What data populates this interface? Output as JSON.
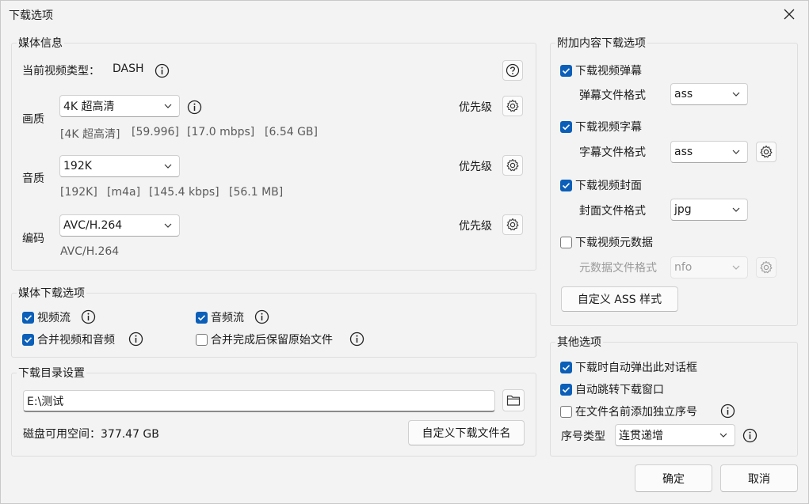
{
  "window": {
    "title": "下载选项"
  },
  "media_info": {
    "group_title": "媒体信息",
    "type_label": "当前视频类型：",
    "type_value": "DASH",
    "quality_label": "画质",
    "quality_value": "4K 超高清",
    "quality_detail": [
      "[4K 超高清]",
      "[59.996]",
      "[17.0 mbps]",
      "[6.54 GB]"
    ],
    "audio_label": "音质",
    "audio_value": "192K",
    "audio_detail": [
      "[192K]",
      "[m4a]",
      "[145.4 kbps]",
      "[56.1 MB]"
    ],
    "codec_label": "编码",
    "codec_value": "AVC/H.264",
    "codec_detail": "AVC/H.264",
    "priority_label": "优先级"
  },
  "media_download": {
    "group_title": "媒体下载选项",
    "video_stream": {
      "label": "视频流",
      "checked": true
    },
    "audio_stream": {
      "label": "音频流",
      "checked": true
    },
    "merge": {
      "label": "合并视频和音频",
      "checked": true
    },
    "keep_original": {
      "label": "合并完成后保留原始文件",
      "checked": false
    }
  },
  "directory": {
    "group_title": "下载目录设置",
    "path": "E:\\测试",
    "disk_label": "磁盘可用空间：377.47 GB",
    "custom_name_button": "自定义下载文件名"
  },
  "extra": {
    "group_title": "附加内容下载选项",
    "danmaku": {
      "label": "下载视频弹幕",
      "checked": true,
      "format_label": "弹幕文件格式",
      "format_value": "ass"
    },
    "subtitle": {
      "label": "下载视频字幕",
      "checked": true,
      "format_label": "字幕文件格式",
      "format_value": "ass"
    },
    "cover": {
      "label": "下载视频封面",
      "checked": true,
      "format_label": "封面文件格式",
      "format_value": "jpg"
    },
    "metadata": {
      "label": "下载视频元数据",
      "checked": false,
      "format_label": "元数据文件格式",
      "format_value": "nfo"
    },
    "ass_style_button": "自定义 ASS 样式"
  },
  "other": {
    "group_title": "其他选项",
    "auto_popup": {
      "label": "下载时自动弹出此对话框",
      "checked": true
    },
    "auto_jump": {
      "label": "自动跳转下载窗口",
      "checked": true
    },
    "add_index": {
      "label": "在文件名前添加独立序号",
      "checked": false
    },
    "index_type_label": "序号类型",
    "index_type_value": "连贯递增"
  },
  "footer": {
    "ok": "确定",
    "cancel": "取消"
  },
  "colors": {
    "accent": "#0b5fb8",
    "window_bg": "#f3f3f3"
  },
  "icons": [
    "close-icon",
    "info-icon",
    "help-icon",
    "gear-icon",
    "chevron-down-icon",
    "folder-icon",
    "checkmark-icon"
  ]
}
